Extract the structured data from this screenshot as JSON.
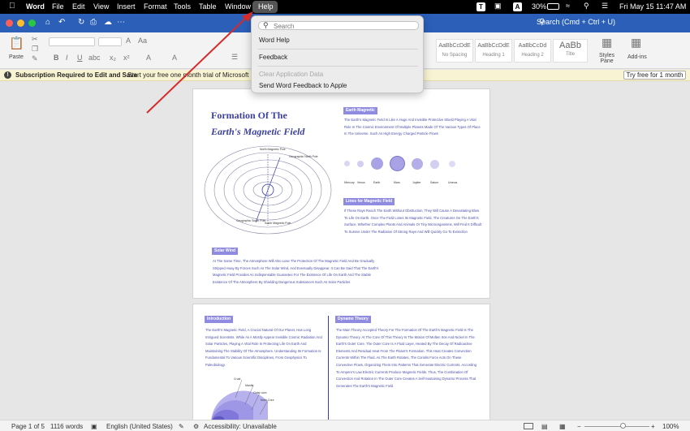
{
  "menubar": {
    "app": "Word",
    "items": [
      "File",
      "Edit",
      "View",
      "Insert",
      "Format",
      "Tools",
      "Table",
      "Window",
      "Help"
    ],
    "battery": "30%",
    "datetime": "Fri May 15  11:47 AM"
  },
  "titlebar": {
    "search_label": "Search (Cmd + Ctrl + U)"
  },
  "ribbon": {
    "paste_label": "Paste",
    "styles": [
      {
        "preview": "AaBbCcDdE",
        "name": "No Spacing"
      },
      {
        "preview": "AaBbCcDdE",
        "name": "Heading 1"
      },
      {
        "preview": "AaBbCcDd",
        "name": "Heading 2"
      },
      {
        "preview": "AaBb",
        "name": "Title"
      }
    ],
    "styles_pane": "Styles\nPane",
    "addins": "Add-ins"
  },
  "notification": {
    "title": "Subscription Required to Edit and Save",
    "message": "Start your free one month trial of Microsoft 36",
    "button": "Try free for 1 month"
  },
  "help_menu": {
    "search_placeholder": "Search",
    "items": [
      "Word Help",
      "Feedback",
      "Clear Application Data",
      "Send Word Feedback to Apple"
    ]
  },
  "document": {
    "page1": {
      "title_line1": "Formation Of The",
      "title_line2": "Earth's  Magnetic Field",
      "tag_earth": "Earth Magnetic",
      "para_earth": "The Earth's Magnetic Field Is Like A Huge And Invisible Protective Shield Playing A Vital Role In The Cosmic Environment Of Multiple Planets Made Of The Various Types Of Place In The Universe. Such As High Energy Charged Particle Flows",
      "tag_lines": "Lines for Magnetic Field",
      "para_lines": "If These Rays Reach The Earth Without Obstruction, They Will Cause A Devastating Blow To Life On Earth. Once The Field Loses Its Magnetic Field, The Creatures On The Earth's Surface, Whether Complex Plants And Animals Or Tiny Microorganisms, Will Find It Difficult To Survive Under The Radiation Of Strong Rays And Will Quickly Go To Extinction",
      "tag_solar": "Solar Wind",
      "para_solar": "At The Same Time, The Atmosphere Will Also Lose The Protection Of The Magnetic Field And Be Gradually Stripped Away By Forces Such As The Solar Wind, And Eventually Disappear. It Can Be Said That The Earth's Magnetic Field Provides An Indispensable Guarantee For The Existence Of Life On Earth And The Stable Existence Of The Atmosphere By Shielding Dangerous Substances Such As Solar Particles",
      "diagram_labels": [
        "North Magnetic Pole",
        "Geographic North Pole",
        "Geographic South Pole",
        "South Magnetic Pole"
      ],
      "planet_labels": [
        "Mercury",
        "Venus",
        "Earth",
        "Mars",
        "Jupiter",
        "Saturn",
        "Uranus",
        "Neptune"
      ]
    },
    "page2": {
      "tag_intro": "Introduction",
      "para_intro": "The Earth's Magnetic Field, A Crucial Natural Of Our Planet, Has Long Intrigued Scientists. While As A Mostly Appear Invisible Cosmic Radiation And Solar Particles, Playing A Vital Role In Protecting Life On Earth And Maintaining The Stability Of The Atmosphere. Understanding Its Formation Is Fundamental To Various Scientific Disciplines, From Geophysics To Paleobiology.",
      "tag_dynamo": "Dynamo Theory",
      "para_dynamo": "The Main Theory Accepted Theory For The Formation Of The Earth's Magnetic Field Is The Dynamo Theory. At The Core Of This Theory Is The Motion Of Molten Iron And Nickel In The Earth's Outer Core. The Outer Core Is A Fluid Layer, Heated By The Decay Of Radioactive Elements And Residual Heat From The Planet's Formation. This Heat Creates Convection Currents Within The Fluid. As The Earth Rotates, The Coriolis Force Acts On These Convective Flows, Organizing Them Into Patterns That Generate Electric Currents. According To Ampere's Law Electric Currents Produce Magnetic Fields. Thus, The Combination Of Convection And Rotation In The Outer Core Creates A Self-Sustaining Dynamo Process That Generates The Earth's Magnetic Field",
      "layer_labels": [
        "Crust",
        "Mantle",
        "Outer core",
        "Inner Core"
      ]
    }
  },
  "statusbar": {
    "page": "Page 1 of 5",
    "words": "1116 words",
    "language": "English (United States)",
    "accessibility": "Accessibility: Unavailable",
    "zoom": "100%"
  }
}
